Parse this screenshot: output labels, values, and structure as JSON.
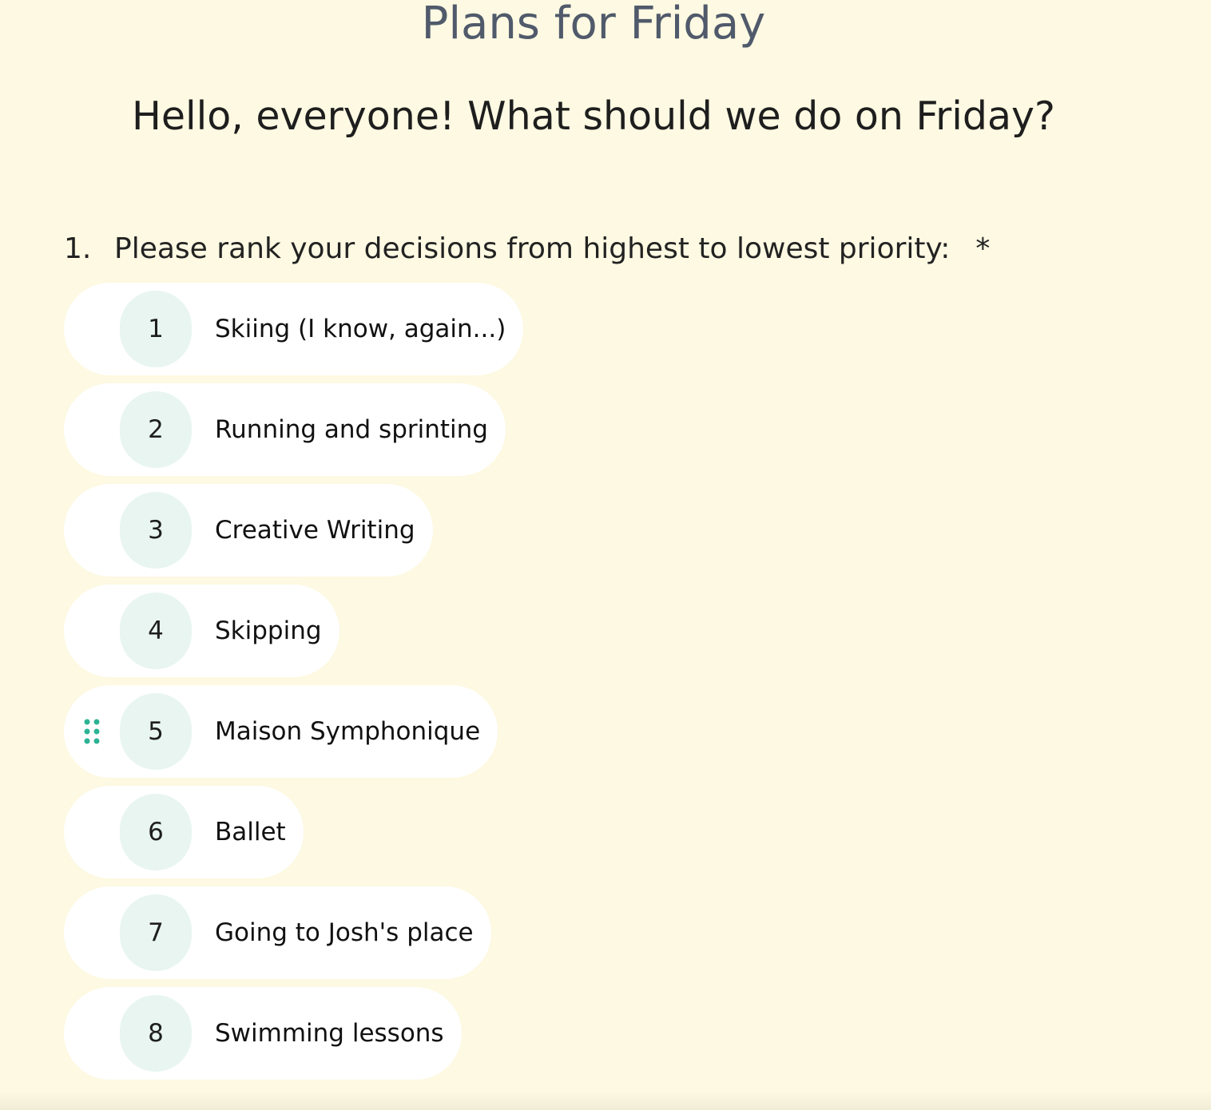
{
  "form": {
    "title": "Plans for Friday",
    "description": "Hello, everyone! What should we do on Friday?"
  },
  "question": {
    "number": "1.",
    "text": "Please rank your decisions from highest to lowest priority:",
    "required_marker": "*",
    "drag_handle_icon": "drag-grip-icon",
    "accent_color": "#2bb394",
    "active_item_index": 4,
    "items": [
      {
        "rank": "1",
        "label": "Skiing (I know, again...)"
      },
      {
        "rank": "2",
        "label": "Running and sprinting"
      },
      {
        "rank": "3",
        "label": "Creative Writing"
      },
      {
        "rank": "4",
        "label": "Skipping"
      },
      {
        "rank": "5",
        "label": "Maison Symphonique"
      },
      {
        "rank": "6",
        "label": "Ballet"
      },
      {
        "rank": "7",
        "label": "Going to Josh's place"
      },
      {
        "rank": "8",
        "label": "Swimming lessons"
      }
    ]
  }
}
